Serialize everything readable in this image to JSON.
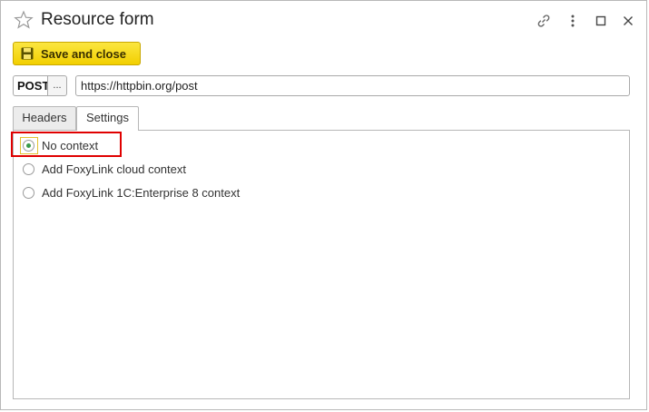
{
  "window": {
    "title": "Resource form"
  },
  "icons": {
    "favorite": "star-icon",
    "link": "link-icon",
    "more": "more-vertical-icon",
    "maximize": "maximize-icon",
    "close": "close-icon",
    "save": "floppy-disk-icon"
  },
  "toolbar": {
    "save_label": "Save and close"
  },
  "request": {
    "method": "POST",
    "method_select_label": "...",
    "url": "https://httpbin.org/post"
  },
  "tabs": [
    {
      "label": "Headers",
      "active": false
    },
    {
      "label": "Settings",
      "active": true
    }
  ],
  "settings": {
    "context_options": [
      {
        "label": "No context",
        "selected": true
      },
      {
        "label": "Add FoxyLink cloud context",
        "selected": false
      },
      {
        "label": "Add FoxyLink 1C:Enterprise 8 context",
        "selected": false
      }
    ]
  },
  "colors": {
    "accent_button": "#f2cf00",
    "radio_selected": "#3a9a4a",
    "highlight": "#e00000"
  }
}
